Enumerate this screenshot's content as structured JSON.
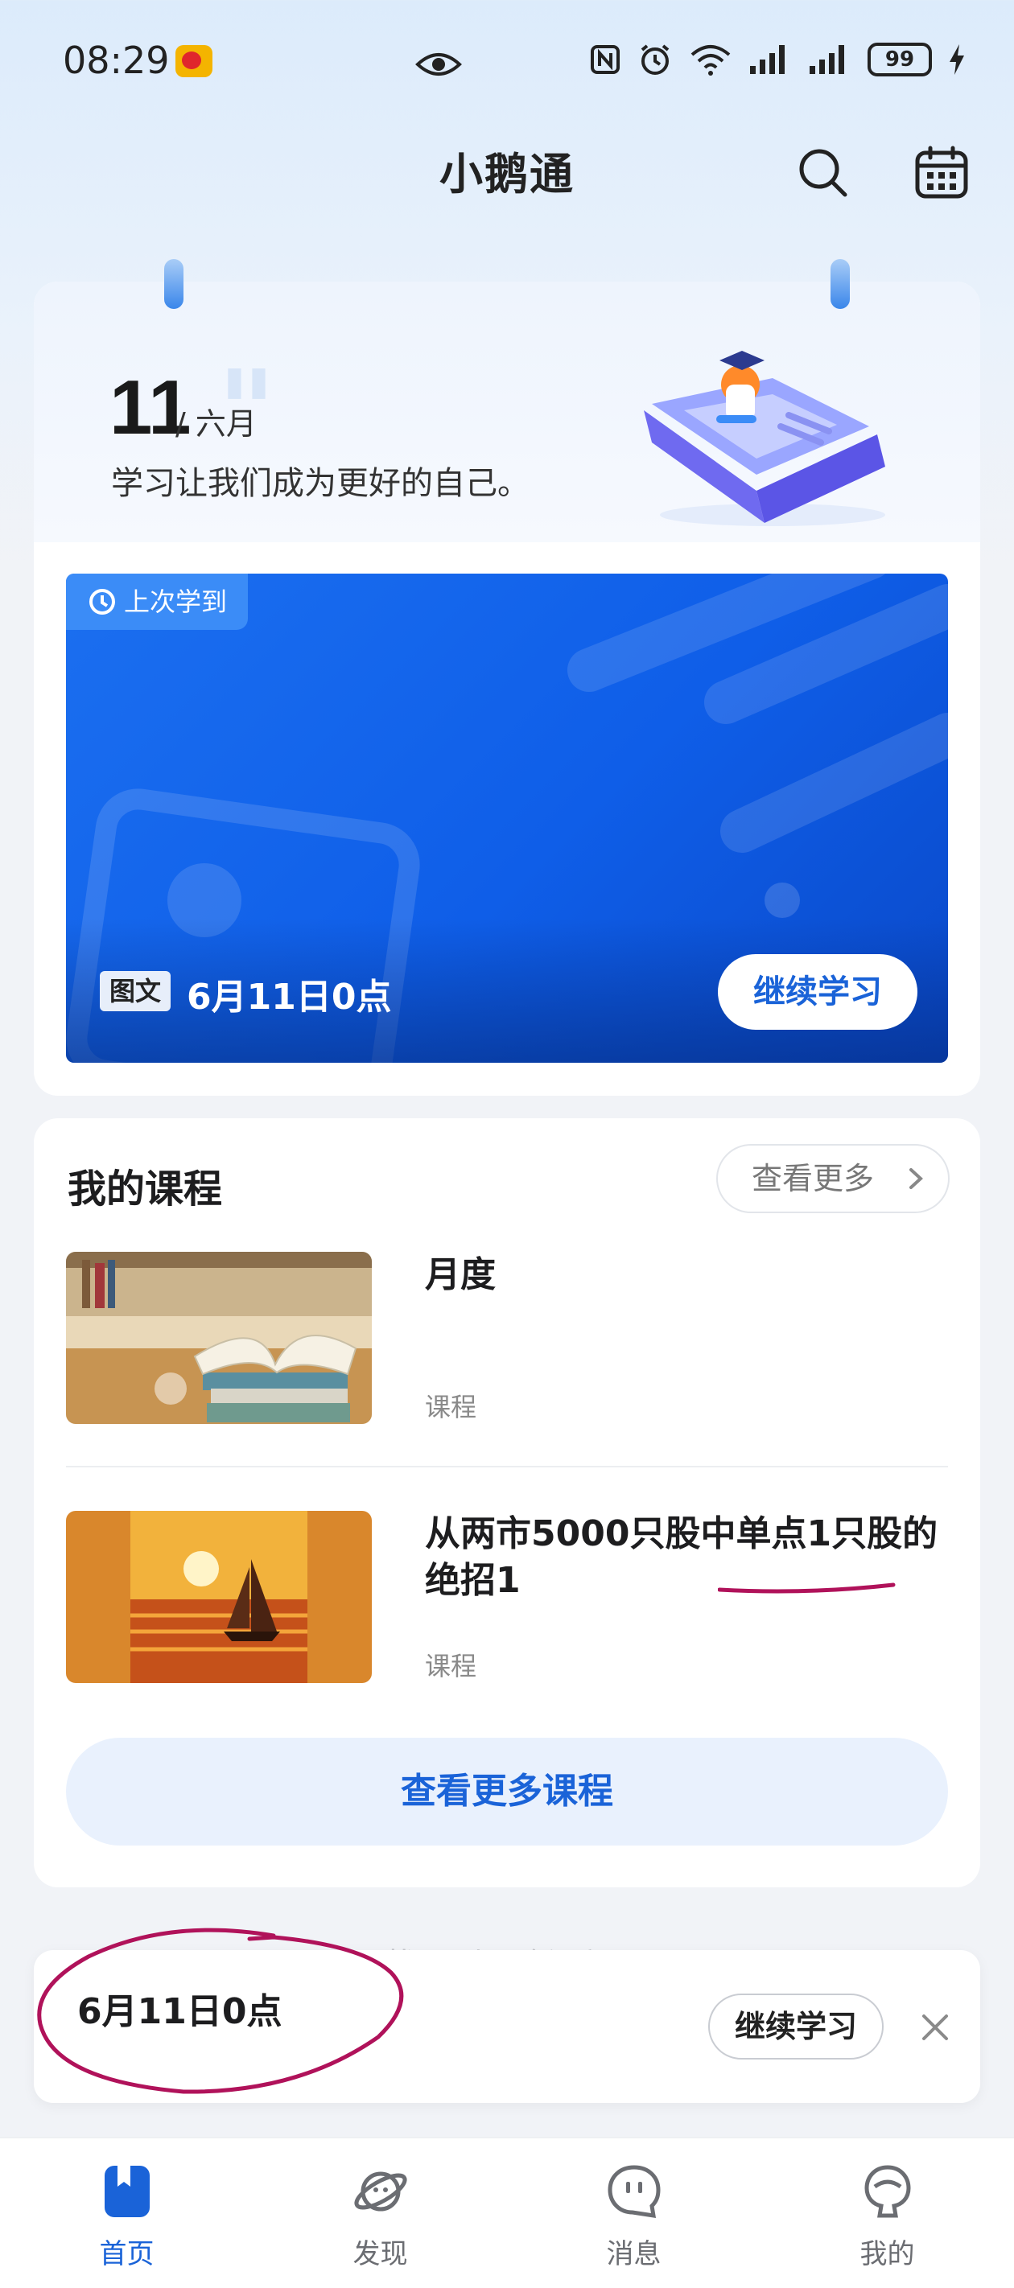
{
  "status_bar": {
    "time": "08:29",
    "battery": "99",
    "icons": [
      "weibo-icon",
      "eye-icon",
      "nfc-icon",
      "alarm-icon",
      "wifi-icon",
      "signal-icon",
      "battery-icon",
      "charging-icon"
    ]
  },
  "header": {
    "title": "小鹅通",
    "icons": [
      "search-icon",
      "calendar-icon"
    ]
  },
  "hero": {
    "day": "11",
    "month": "/ 六月",
    "motto": "学习让我们成为更好的自己。",
    "last_learned_label": "上次学到",
    "content_type": "图文",
    "content_title": "6月11日0点",
    "continue_label": "继续学习"
  },
  "my_courses": {
    "title": "我的课程",
    "see_more_label": "查看更多",
    "items": [
      {
        "name": "月度",
        "type": "课程"
      },
      {
        "name": "从两市5000只股中单点1只股的绝招1",
        "type": "课程"
      }
    ],
    "more_courses_label": "查看更多课程"
  },
  "hint_text": "找不到已购课程?",
  "mini_player": {
    "title": "6月11日0点",
    "continue_label": "继续学习"
  },
  "bottom_nav": {
    "items": [
      {
        "label": "首页",
        "icon": "home-book-icon",
        "active": true
      },
      {
        "label": "发现",
        "icon": "planet-icon",
        "active": false
      },
      {
        "label": "消息",
        "icon": "message-icon",
        "active": false
      },
      {
        "label": "我的",
        "icon": "profile-icon",
        "active": false
      }
    ]
  },
  "colors": {
    "accent": "#1a63d8",
    "banner_blue": "#0f5ee8",
    "annotation_ink": "#b0125a"
  }
}
